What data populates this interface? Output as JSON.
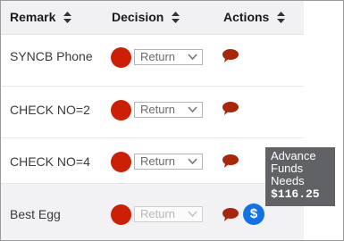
{
  "header": {
    "remark": "Remark",
    "decision": "Decision",
    "actions": "Actions"
  },
  "rows": [
    {
      "remark": "SYNCB Phone",
      "decision": "Return"
    },
    {
      "remark": "CHECK NO=2",
      "decision": "Return"
    },
    {
      "remark": "CHECK NO=4",
      "decision": "Return"
    },
    {
      "remark": "Best Egg",
      "decision": "Return"
    }
  ],
  "tooltip": {
    "line1": "Advance",
    "line2": "Funds",
    "line3": "Needs",
    "amount": "$116.25"
  },
  "dollar_icon_label": "$",
  "colors": {
    "status_dot": "#cc1f05",
    "comment_icon": "#a8260a",
    "dollar_badge": "#1271e6",
    "tooltip_bg": "#606266"
  },
  "icons": [
    "sort-icon",
    "chevron-down-icon",
    "comment-icon",
    "dollar-icon"
  ]
}
